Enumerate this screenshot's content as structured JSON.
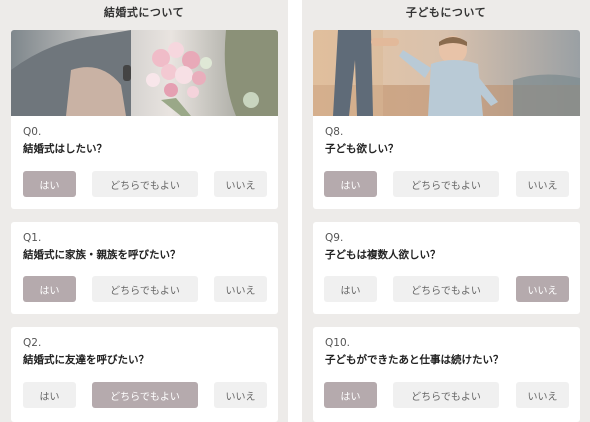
{
  "left": {
    "title": "結婚式について",
    "questions": [
      {
        "num": "Q0.",
        "text": "結婚式はしたい？",
        "selected": "yes"
      },
      {
        "num": "Q1.",
        "text": "結婚式に家族・親族を呼びたい？",
        "selected": "yes"
      },
      {
        "num": "Q2.",
        "text": "結婚式に友達を呼びたい？",
        "selected": "either"
      }
    ]
  },
  "right": {
    "title": "子どもについて",
    "questions": [
      {
        "num": "Q8.",
        "text": "子ども欲しい？",
        "selected": "yes"
      },
      {
        "num": "Q9.",
        "text": "子どもは複数人欲しい？",
        "selected": "no"
      },
      {
        "num": "Q10.",
        "text": "子どもができたあと仕事は続けたい？",
        "selected": "yes"
      }
    ]
  },
  "options": {
    "yes": "はい",
    "either": "どちらでもよい",
    "no": "いいえ"
  },
  "colors": {
    "selected": "#b5aaad",
    "unselected": "#f0f0f0",
    "panel_bg": "#edebe9"
  }
}
